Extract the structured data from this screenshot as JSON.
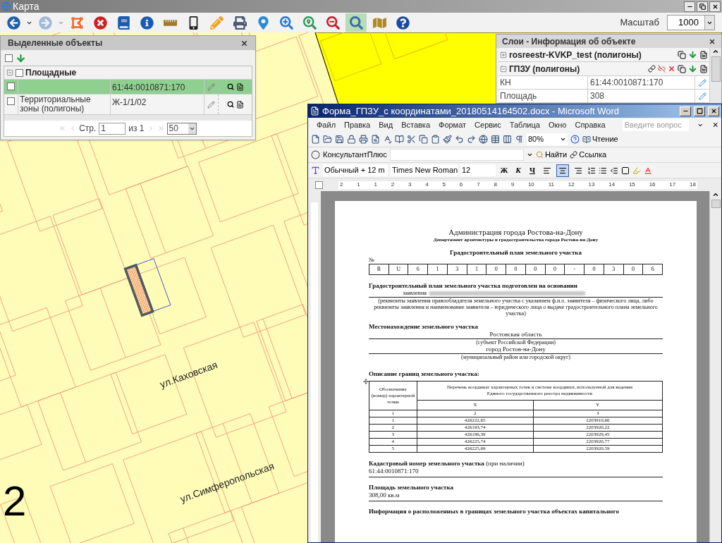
{
  "window": {
    "title": "Карта"
  },
  "toolbar": {
    "tools": [
      {
        "kind": "back",
        "selected": false
      },
      {
        "kind": "forward",
        "selected": false
      },
      {
        "kind": "polygon",
        "selected": false
      },
      {
        "kind": "clear",
        "selected": false
      },
      {
        "kind": "book",
        "selected": false
      },
      {
        "kind": "info",
        "selected": false
      },
      {
        "kind": "ruler",
        "selected": false
      },
      {
        "kind": "phone",
        "selected": false
      },
      {
        "kind": "pencil",
        "selected": false
      },
      {
        "kind": "print",
        "selected": false
      },
      {
        "kind": "pin",
        "selected": false
      },
      {
        "kind": "zoom-info",
        "selected": false
      },
      {
        "kind": "zoom-home",
        "selected": false
      },
      {
        "kind": "zoom-out",
        "selected": false
      },
      {
        "kind": "search",
        "selected": true
      },
      {
        "kind": "map-book",
        "selected": false
      },
      {
        "kind": "help",
        "selected": false
      }
    ],
    "scale_label": "Масштаб",
    "scale_value": "1000"
  },
  "map": {
    "streets": [
      "ул.Каховская",
      "ул.Симферопольская"
    ],
    "marker": "2"
  },
  "selected_panel": {
    "title": "Выделенные объекты",
    "select_all_checked": false,
    "group": {
      "label": "Площадные",
      "expanded": true,
      "checked": false
    },
    "rows": [
      {
        "checked": false,
        "selected": true,
        "value": "61:44:0010871:170"
      },
      {
        "checked": false,
        "selected": false,
        "layer": "Территориальные зоны (полигоны)",
        "value": "Ж-1/1/02"
      }
    ],
    "pager": {
      "page_label": "Стр.",
      "page": "1",
      "of": "из 1",
      "per_page": "50"
    }
  },
  "layers_panel": {
    "title": "Слои - Информация об объекте",
    "layers": [
      {
        "name": "rosreestr-KVKP_test (полигоны)",
        "expanded": false
      },
      {
        "name": "ГПЗУ (полигоны)",
        "expanded": true,
        "fields": [
          {
            "label": "КН",
            "value": "61:44:0010871:170"
          },
          {
            "label": "Площадь",
            "value": "308"
          }
        ]
      }
    ]
  },
  "word": {
    "title": "Форма_ГПЗУ_с координатами_20180514164502.docx - Microsoft Word",
    "menu": [
      "Файл",
      "Правка",
      "Вид",
      "Вставка",
      "Формат",
      "Сервис",
      "Таблица",
      "Окно",
      "Справка"
    ],
    "help_placeholder": "Введите вопрос",
    "zoom": "80%",
    "reading": "Чтение",
    "consultant": "КонсультантПлюс",
    "find": "Найти",
    "link": "Ссылка",
    "style": "Обычный + 12 m",
    "font": "Times New Roman",
    "size": "12",
    "bold": "Ж",
    "italic": "К",
    "underline": "Ч",
    "alignment": [
      {
        "kind": "left",
        "selected": false
      },
      {
        "kind": "center",
        "selected": true
      },
      {
        "kind": "right",
        "selected": false
      }
    ],
    "ruler_marks": [
      "2",
      "1",
      "1",
      "2",
      "3",
      "4",
      "5",
      "6",
      "7",
      "8",
      "9",
      "10",
      "11",
      "12",
      "13",
      "14",
      "15",
      "16",
      "17",
      "18"
    ],
    "document": {
      "title": "Администрация города Ростова-на-Дону",
      "subtitle": "Департамент архитектуры и градостроительства города Ростова-на-Дону",
      "heading": "Градостроительный план земельного участка",
      "number_label": "№",
      "number_cells": [
        "R",
        "U",
        "6",
        "1",
        "3",
        "1",
        "0",
        "0",
        "0",
        "0",
        "-",
        "0",
        "3",
        "0",
        "6"
      ],
      "basis_heading": "Градостроительный план земельного участка подготовлен на основании",
      "basis_label": "заявления",
      "basis_end": ":",
      "basis_note": "(реквизиты заявления правообладателя земельного участка с указанием ф.и.о. заявителя – физического лица, либо реквизиты заявления и наименование заявителя – юридического лица о выдаче градостроительного плана земельного участка)",
      "location_heading": "Местонахождение земельного участка",
      "location": [
        {
          "value": "Ростовская область",
          "note": "(субъект Российской Федерации)"
        },
        {
          "value": "город Ростов-на-Дону",
          "note": "(муниципальный район или городской округ)"
        }
      ],
      "borders_heading": "Описание границ земельного участка:",
      "table": {
        "point_header": "Обозначение (номер) характерной точки",
        "coords_header": "Перечень координат характерных точек в системе координат, используемой для ведения Единого государственного реестра недвижимости",
        "x_header": "X",
        "y_header": "Y",
        "index_row": [
          "1",
          "2",
          "3"
        ],
        "rows": [
          [
            "1",
            "426222,65",
            "2203910,66"
          ],
          [
            "2",
            "426193,74",
            "2203920,22"
          ],
          [
            "3",
            "426196,39",
            "2203929,45"
          ],
          [
            "4",
            "426225,74",
            "2203920,77"
          ],
          [
            "5",
            "426225,69",
            "2203920,59"
          ]
        ]
      },
      "cadastral_heading": "**Кадастровый номер земельного участка** (при наличии)",
      "cadastral_value": "61:44:0010871:170",
      "area_heading": "Площадь земельного участка",
      "area_value": "308,00 кв.м",
      "info_heading": "Информация о расположенных в границах земельного участка объектах капитального"
    }
  }
}
